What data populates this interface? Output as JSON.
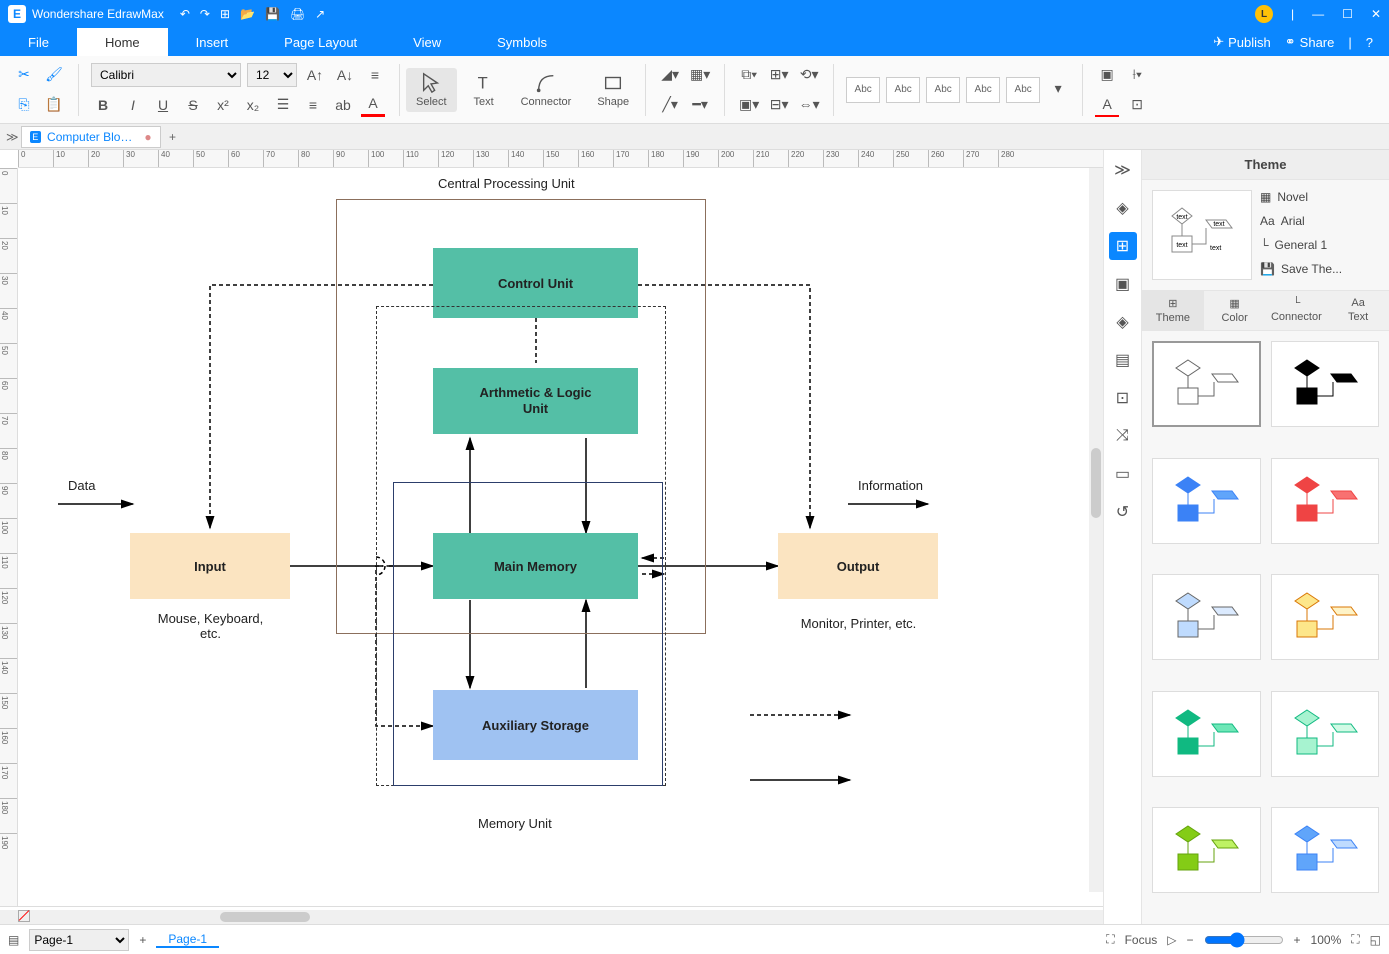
{
  "titlebar": {
    "app_name": "Wondershare EdrawMax",
    "avatar_letter": "L"
  },
  "menutabs": {
    "tabs": [
      "File",
      "Home",
      "Insert",
      "Page Layout",
      "View",
      "Symbols"
    ],
    "active_index": 1,
    "publish": "Publish",
    "share": "Share"
  },
  "ribbon": {
    "font_name": "Calibri",
    "font_size": "12",
    "tool_select": "Select",
    "tool_text": "Text",
    "tool_connector": "Connector",
    "tool_shape": "Shape",
    "shape_abc": "Abc"
  },
  "doctabs": {
    "name": "Computer Block..."
  },
  "ruler_h": [
    "0",
    "10",
    "20",
    "30",
    "40",
    "50",
    "60",
    "70",
    "80",
    "90",
    "100",
    "110",
    "120",
    "130",
    "140",
    "150",
    "160",
    "170",
    "180",
    "190",
    "200",
    "210",
    "220",
    "230",
    "240",
    "250",
    "260",
    "270",
    "280"
  ],
  "ruler_v": [
    "0",
    "10",
    "20",
    "30",
    "40",
    "50",
    "60",
    "70",
    "80",
    "90",
    "100",
    "110",
    "120",
    "130",
    "140",
    "150",
    "160",
    "170",
    "180",
    "190"
  ],
  "diagram": {
    "title_top": "Central Processing Unit",
    "title_bottom": "Memory Unit",
    "control_unit": "Control Unit",
    "alu1": "Arthmetic & Logic",
    "alu2": "Unit",
    "main_memory": "Main Memory",
    "aux_storage": "Auxiliary Storage",
    "input": "Input",
    "input_sub": "Mouse, Keyboard, etc.",
    "output": "Output",
    "output_sub": "Monitor, Printer, etc.",
    "data": "Data",
    "information": "Information"
  },
  "rightpanel": {
    "title": "Theme",
    "theme_name": "Novel",
    "font": "Arial",
    "connector": "General 1",
    "save": "Save The...",
    "subtabs": [
      "Theme",
      "Color",
      "Connector",
      "Text"
    ],
    "preview_text": "text"
  },
  "statusbar": {
    "page_select": "Page-1",
    "page_tab": "Page-1",
    "focus": "Focus",
    "zoom": "100%"
  },
  "colors": [
    "#000000",
    "#262626",
    "#404040",
    "#595959",
    "#7f7f7f",
    "#a6a6a6",
    "#bfbfbf",
    "#d9d9d9",
    "#f2f2f2",
    "#ffffff",
    "#7f0000",
    "#ff0000",
    "#ff6600",
    "#ffcc00",
    "#ccff00",
    "#66ff00",
    "#00ff00",
    "#00ff66",
    "#00ffcc",
    "#00ccff",
    "#0066ff",
    "#0000ff",
    "#6600ff",
    "#cc00ff",
    "#ff00cc",
    "#ff0066",
    "#c00000",
    "#e06666",
    "#f6b26b",
    "#ffd966",
    "#d9ead3",
    "#93c47d",
    "#6aa84f",
    "#76a5af",
    "#6fa8dc",
    "#8e7cc3",
    "#b4a7d6",
    "#d5a6bd",
    "#cc4125",
    "#a61c00",
    "#85200c",
    "#990000",
    "#b45f06",
    "#bf9000",
    "#38761d",
    "#134f5c",
    "#1155cc",
    "#0b5394",
    "#351c75",
    "#741b47",
    "#5b0f00",
    "#660000",
    "#783f04",
    "#7f6000",
    "#274e13",
    "#0c343d",
    "#1c4587",
    "#073763",
    "#20124d",
    "#4c1130",
    "#8b4513",
    "#a0522d",
    "#cd853f",
    "#d2b48c",
    "#333333",
    "#555555",
    "#777777",
    "#999999"
  ]
}
